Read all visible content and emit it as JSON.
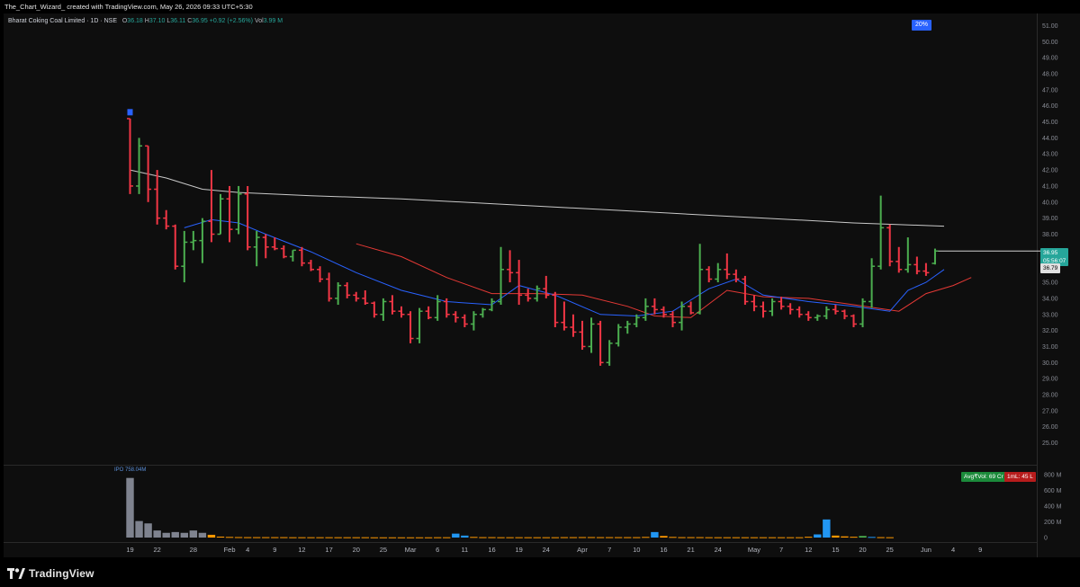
{
  "header": {
    "credit": "The_Chart_Wizard_ created with TradingView.com, May 26, 2026 09:33 UTC+5:30"
  },
  "legend": {
    "symbol": "Bharat Coking Coal Limited · 1D · NSE",
    "o_label": "O",
    "o_value": "36.18",
    "h_label": "H",
    "h_value": "37.10",
    "l_label": "L",
    "l_value": "36.11",
    "c_label": "C",
    "c_value": "36.95",
    "change": "+0.92 (+2.56%)",
    "vol_label": "Vol",
    "vol_value": "3.99 M"
  },
  "percent_badge": "20%",
  "price_labels": {
    "last_price": "36.95",
    "countdown": "05:56:07",
    "ma_value": "36.79"
  },
  "volume_pane": {
    "ipo_label": "IPO 758.04M",
    "avg_vol_label": "Avg₹Vol: 69 Cr",
    "value_label": "1mL: 45 L",
    "y_ticks": [
      "800 M",
      "600 M",
      "400 M",
      "200 M",
      "0"
    ]
  },
  "footer": {
    "brand": "TradingView"
  },
  "colors": {
    "up": "#4caf50",
    "down": "#f23645",
    "ma_fast": "#2962ff",
    "ma_mid": "#e53935",
    "ma_slow": "#c9c9c9",
    "vol_ipo": "#7f838f",
    "vol_orange": "#ff9800",
    "vol_blue": "#2196f3"
  },
  "chart_data": {
    "type": "ohlc",
    "y_ticks": [
      "51.00",
      "50.00",
      "49.00",
      "48.00",
      "47.00",
      "46.00",
      "45.00",
      "44.00",
      "43.00",
      "42.00",
      "41.00",
      "40.00",
      "39.00",
      "38.00",
      "37.00",
      "36.00",
      "35.00",
      "34.00",
      "33.00",
      "32.00",
      "31.00",
      "30.00",
      "29.00",
      "28.00",
      "27.00",
      "26.00",
      "25.00"
    ],
    "ylim": [
      24.5,
      51.5
    ],
    "x_labels": [
      {
        "label": "19",
        "i": 0
      },
      {
        "label": "22",
        "i": 3
      },
      {
        "label": "28",
        "i": 7
      },
      {
        "label": "Feb",
        "i": 11
      },
      {
        "label": "4",
        "i": 13
      },
      {
        "label": "9",
        "i": 16
      },
      {
        "label": "12",
        "i": 19
      },
      {
        "label": "17",
        "i": 22
      },
      {
        "label": "20",
        "i": 25
      },
      {
        "label": "25",
        "i": 28
      },
      {
        "label": "Mar",
        "i": 31
      },
      {
        "label": "6",
        "i": 34
      },
      {
        "label": "11",
        "i": 37
      },
      {
        "label": "16",
        "i": 40
      },
      {
        "label": "19",
        "i": 43
      },
      {
        "label": "24",
        "i": 46
      },
      {
        "label": "Apr",
        "i": 50
      },
      {
        "label": "7",
        "i": 53
      },
      {
        "label": "10",
        "i": 56
      },
      {
        "label": "16",
        "i": 59
      },
      {
        "label": "21",
        "i": 62
      },
      {
        "label": "24",
        "i": 65
      },
      {
        "label": "May",
        "i": 69
      },
      {
        "label": "7",
        "i": 72
      },
      {
        "label": "12",
        "i": 75
      },
      {
        "label": "15",
        "i": 78
      },
      {
        "label": "20",
        "i": 81
      },
      {
        "label": "25",
        "i": 84
      },
      {
        "label": "Jun",
        "i": 88
      },
      {
        "label": "4",
        "i": 91
      },
      {
        "label": "9",
        "i": 94
      }
    ],
    "bars": [
      [
        45.2,
        45.2,
        40.5,
        41.0
      ],
      [
        41.0,
        44.0,
        40.5,
        43.5
      ],
      [
        43.5,
        43.5,
        40.0,
        40.8
      ],
      [
        40.8,
        42.0,
        38.6,
        39.0
      ],
      [
        39.0,
        39.5,
        38.3,
        38.5
      ],
      [
        38.5,
        38.6,
        35.8,
        36.0
      ],
      [
        36.0,
        38.2,
        35.0,
        37.5
      ],
      [
        37.5,
        38.2,
        37.0,
        37.6
      ],
      [
        37.6,
        39.0,
        36.2,
        38.8
      ],
      [
        38.8,
        42.0,
        37.5,
        38.0
      ],
      [
        38.0,
        40.5,
        38.0,
        40.2
      ],
      [
        40.2,
        41.0,
        37.5,
        38.3
      ],
      [
        38.3,
        41.0,
        38.0,
        40.5
      ],
      [
        40.5,
        41.0,
        37.0,
        37.2
      ],
      [
        37.2,
        38.2,
        36.0,
        37.8
      ],
      [
        37.8,
        38.0,
        36.5,
        37.2
      ],
      [
        37.2,
        37.8,
        37.0,
        37.1
      ],
      [
        37.1,
        37.3,
        36.5,
        36.6
      ],
      [
        36.6,
        37.0,
        36.3,
        37.0
      ],
      [
        37.0,
        37.2,
        36.0,
        36.2
      ],
      [
        36.2,
        36.4,
        35.7,
        35.8
      ],
      [
        35.8,
        36.0,
        35.0,
        35.2
      ],
      [
        35.2,
        35.6,
        33.8,
        34.0
      ],
      [
        34.0,
        35.0,
        33.6,
        34.8
      ],
      [
        34.8,
        35.0,
        34.0,
        34.2
      ],
      [
        34.2,
        34.4,
        33.8,
        34.0
      ],
      [
        34.0,
        34.5,
        33.6,
        33.7
      ],
      [
        33.7,
        33.8,
        32.8,
        33.0
      ],
      [
        33.0,
        34.0,
        32.6,
        33.8
      ],
      [
        33.8,
        34.2,
        33.0,
        33.2
      ],
      [
        33.2,
        33.5,
        32.8,
        33.0
      ],
      [
        33.0,
        33.2,
        31.2,
        31.5
      ],
      [
        31.5,
        33.4,
        31.2,
        33.2
      ],
      [
        33.2,
        33.5,
        32.7,
        32.8
      ],
      [
        32.8,
        34.2,
        32.6,
        33.8
      ],
      [
        33.8,
        34.0,
        32.8,
        33.0
      ],
      [
        33.0,
        33.2,
        32.5,
        32.8
      ],
      [
        32.8,
        33.0,
        32.2,
        32.4
      ],
      [
        32.4,
        33.2,
        32.0,
        33.0
      ],
      [
        33.0,
        33.4,
        32.8,
        33.3
      ],
      [
        33.3,
        34.0,
        33.2,
        33.8
      ],
      [
        33.8,
        37.2,
        33.6,
        35.8
      ],
      [
        35.8,
        37.0,
        35.0,
        35.6
      ],
      [
        35.6,
        36.4,
        33.6,
        34.2
      ],
      [
        34.2,
        34.6,
        33.8,
        34.0
      ],
      [
        34.0,
        34.8,
        33.8,
        34.6
      ],
      [
        34.6,
        35.4,
        34.0,
        34.2
      ],
      [
        34.2,
        34.4,
        32.2,
        32.5
      ],
      [
        32.5,
        33.8,
        32.0,
        32.2
      ],
      [
        32.2,
        33.0,
        31.6,
        31.9
      ],
      [
        31.9,
        32.6,
        30.8,
        31.0
      ],
      [
        31.0,
        32.8,
        30.6,
        32.4
      ],
      [
        32.4,
        32.6,
        29.8,
        30.0
      ],
      [
        30.0,
        31.4,
        29.8,
        31.2
      ],
      [
        31.2,
        32.4,
        31.0,
        32.2
      ],
      [
        32.2,
        32.6,
        31.8,
        32.4
      ],
      [
        32.4,
        33.0,
        32.2,
        32.8
      ],
      [
        32.8,
        34.0,
        32.6,
        33.5
      ],
      [
        33.5,
        34.0,
        33.0,
        33.3
      ],
      [
        33.3,
        33.5,
        32.8,
        33.0
      ],
      [
        33.0,
        33.2,
        32.2,
        32.5
      ],
      [
        32.5,
        33.8,
        32.0,
        33.5
      ],
      [
        33.5,
        33.8,
        33.0,
        33.1
      ],
      [
        33.1,
        37.4,
        33.0,
        35.8
      ],
      [
        35.8,
        36.0,
        35.0,
        35.2
      ],
      [
        35.2,
        36.2,
        35.0,
        35.8
      ],
      [
        35.8,
        36.8,
        35.2,
        35.5
      ],
      [
        35.5,
        35.8,
        35.0,
        35.2
      ],
      [
        35.2,
        35.4,
        33.6,
        33.8
      ],
      [
        33.8,
        34.2,
        33.2,
        33.5
      ],
      [
        33.5,
        33.8,
        32.8,
        33.2
      ],
      [
        33.2,
        34.0,
        32.9,
        33.8
      ],
      [
        33.8,
        34.1,
        33.3,
        33.5
      ],
      [
        33.5,
        33.7,
        33.0,
        33.3
      ],
      [
        33.3,
        33.5,
        32.8,
        33.0
      ],
      [
        33.0,
        33.2,
        32.6,
        32.8
      ],
      [
        32.8,
        33.0,
        32.6,
        32.9
      ],
      [
        32.9,
        33.5,
        32.7,
        33.3
      ],
      [
        33.3,
        33.6,
        33.0,
        33.2
      ],
      [
        33.2,
        33.3,
        32.7,
        32.9
      ],
      [
        32.9,
        33.0,
        32.2,
        32.4
      ],
      [
        32.4,
        34.0,
        32.2,
        33.8
      ],
      [
        33.8,
        36.5,
        33.4,
        36.0
      ],
      [
        36.0,
        40.4,
        35.8,
        38.4
      ],
      [
        38.4,
        38.6,
        36.0,
        36.3
      ],
      [
        36.3,
        37.2,
        35.6,
        35.8
      ],
      [
        35.8,
        37.8,
        35.6,
        36.1
      ],
      [
        36.1,
        36.6,
        35.5,
        35.7
      ],
      [
        35.7,
        36.2,
        35.4,
        35.6
      ],
      [
        36.18,
        37.1,
        36.11,
        36.95
      ]
    ],
    "ma_slow": [
      [
        0,
        42.0
      ],
      [
        4,
        41.5
      ],
      [
        8,
        40.8
      ],
      [
        12,
        40.6
      ],
      [
        20,
        40.4
      ],
      [
        30,
        40.2
      ],
      [
        40,
        39.9
      ],
      [
        50,
        39.6
      ],
      [
        60,
        39.3
      ],
      [
        70,
        39.0
      ],
      [
        80,
        38.7
      ],
      [
        90,
        38.5
      ]
    ],
    "ma_fast": [
      [
        6,
        38.4
      ],
      [
        9,
        38.9
      ],
      [
        12,
        38.7
      ],
      [
        15,
        38.0
      ],
      [
        20,
        36.9
      ],
      [
        25,
        35.6
      ],
      [
        30,
        34.5
      ],
      [
        35,
        33.8
      ],
      [
        40,
        33.6
      ],
      [
        43,
        34.8
      ],
      [
        47,
        34.2
      ],
      [
        52,
        33.0
      ],
      [
        56,
        32.9
      ],
      [
        60,
        33.2
      ],
      [
        64,
        34.6
      ],
      [
        67,
        35.2
      ],
      [
        70,
        34.2
      ],
      [
        75,
        33.8
      ],
      [
        80,
        33.5
      ],
      [
        84,
        33.2
      ],
      [
        86,
        34.5
      ],
      [
        88,
        35.0
      ],
      [
        90,
        35.8
      ]
    ],
    "ma_mid": [
      [
        25,
        37.4
      ],
      [
        30,
        36.6
      ],
      [
        35,
        35.3
      ],
      [
        40,
        34.3
      ],
      [
        45,
        34.3
      ],
      [
        50,
        34.2
      ],
      [
        55,
        33.5
      ],
      [
        58,
        32.9
      ],
      [
        62,
        32.8
      ],
      [
        66,
        34.5
      ],
      [
        70,
        34.1
      ],
      [
        75,
        34.0
      ],
      [
        80,
        33.6
      ],
      [
        85,
        33.2
      ],
      [
        88,
        34.3
      ],
      [
        91,
        34.8
      ],
      [
        93,
        35.3
      ]
    ],
    "volume_ylim": [
      0,
      800
    ],
    "volume": [
      758,
      210,
      180,
      90,
      60,
      70,
      60,
      90,
      60,
      35,
      12,
      8,
      6,
      5,
      5,
      5,
      5,
      5,
      4,
      4,
      4,
      4,
      4,
      4,
      4,
      4,
      4,
      3,
      3,
      3,
      3,
      3,
      3,
      3,
      4,
      4,
      50,
      25,
      8,
      5,
      5,
      4,
      4,
      4,
      4,
      4,
      4,
      4,
      5,
      5,
      6,
      6,
      5,
      5,
      5,
      5,
      5,
      8,
      70,
      20,
      8,
      5,
      5,
      5,
      4,
      4,
      4,
      4,
      4,
      4,
      4,
      4,
      4,
      4,
      4,
      10,
      40,
      230,
      25,
      15,
      10,
      20,
      8,
      5,
      4
    ],
    "volume_colors": {
      "0": "ipo",
      "1": "ipo",
      "2": "ipo",
      "3": "ipo",
      "4": "ipo",
      "5": "ipo",
      "6": "ipo",
      "7": "ipo",
      "8": "ipo",
      "36": "blue",
      "37": "blue",
      "58": "blue",
      "76": "blue",
      "77": "blue",
      "81": "green",
      "82": "blue"
    }
  }
}
